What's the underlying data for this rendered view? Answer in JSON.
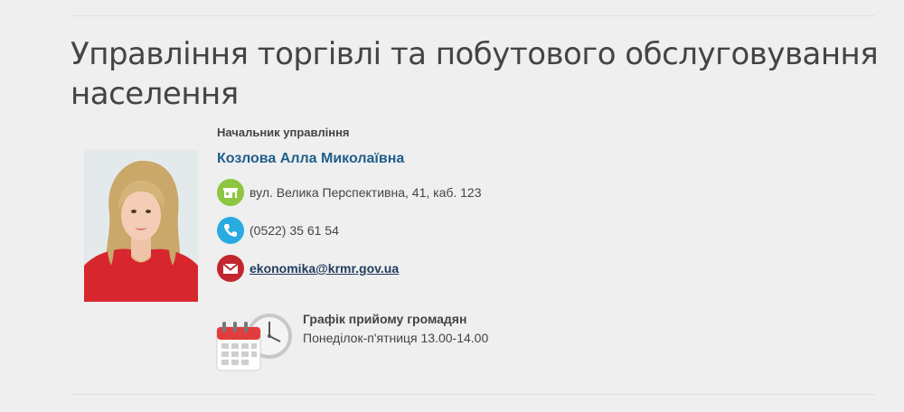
{
  "department": {
    "title": "Управління торгівлі та побутового обслуговування населення"
  },
  "head": {
    "role": "Начальник управління",
    "name": "Козлова Алла Миколаївна",
    "photo_icon": "portrait-photo"
  },
  "contacts": {
    "address": "вул. Велика Перспективна, 41, каб. 123",
    "address_icon": "building-icon",
    "phone": "(0522) 35 61 54",
    "phone_icon": "phone-icon",
    "email": "ekonomika@krmr.gov.ua",
    "email_icon": "mail-icon"
  },
  "schedule": {
    "title": "Графік прийому громадян",
    "time": "Понеділок-п'ятниця 13.00-14.00",
    "icon": "calendar-clock-icon"
  },
  "colors": {
    "name": "#1f5f8b",
    "address_icon_bg": "#8dc63f",
    "phone_icon_bg": "#29abe2",
    "email_icon_bg": "#c1272d",
    "background": "#efefef"
  }
}
